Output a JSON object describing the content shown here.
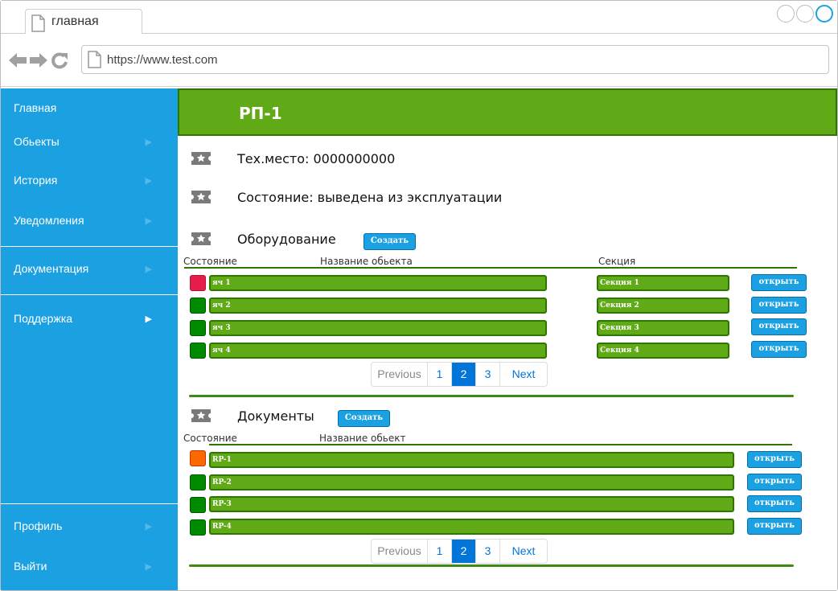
{
  "browser": {
    "tab_title": "главная",
    "url": "https://www.test.com"
  },
  "sidebar": {
    "items": [
      {
        "label": "Главная"
      },
      {
        "label": "Обьекты"
      },
      {
        "label": "История"
      },
      {
        "label": "Уведомления"
      },
      {
        "label": "Документация"
      },
      {
        "label": "Поддержка"
      }
    ],
    "bottom": [
      {
        "label": "Профиль"
      },
      {
        "label": "Выйти"
      }
    ]
  },
  "header": {
    "title": "РП-1"
  },
  "info": {
    "tech_place": "Тех.место: 0000000000",
    "state": "Состояние: выведена из эксплуатации"
  },
  "equipment": {
    "title": "Оборудование",
    "create_label": "Создать",
    "col_state": "Состояние",
    "col_name": "Название обьекта",
    "col_section": "Секция",
    "rows": [
      {
        "status": "red",
        "name": "яч 1",
        "section": "Секция 1",
        "action": "открыть"
      },
      {
        "status": "green",
        "name": "яч 2",
        "section": "Секция 2",
        "action": "открыть"
      },
      {
        "status": "green",
        "name": "яч 3",
        "section": "Секция 3",
        "action": "открыть"
      },
      {
        "status": "green",
        "name": "яч 4",
        "section": "Секция 4",
        "action": "открыть"
      }
    ],
    "pagination": {
      "prev": "Previous",
      "pages": [
        "1",
        "2",
        "3"
      ],
      "active": "2",
      "next": "Next"
    }
  },
  "documents": {
    "title": "Документы",
    "create_label": "Создать",
    "col_state": "Состояние",
    "col_name": "Название обьект",
    "rows": [
      {
        "status": "orange",
        "name": "RP-1",
        "action": "открыть"
      },
      {
        "status": "green",
        "name": "RP-2",
        "action": "открыть"
      },
      {
        "status": "green",
        "name": "RP-3",
        "action": "открыть"
      },
      {
        "status": "green",
        "name": "RP-4",
        "action": "открыть"
      }
    ],
    "pagination": {
      "prev": "Previous",
      "pages": [
        "1",
        "2",
        "3"
      ],
      "active": "2",
      "next": "Next"
    }
  },
  "colors": {
    "sidebar": "#1ba1e2",
    "header": "#60a917",
    "status_red": "#e51d4a",
    "status_green": "#008a00",
    "status_orange": "#fa6800",
    "pager_active": "#0275d8"
  }
}
